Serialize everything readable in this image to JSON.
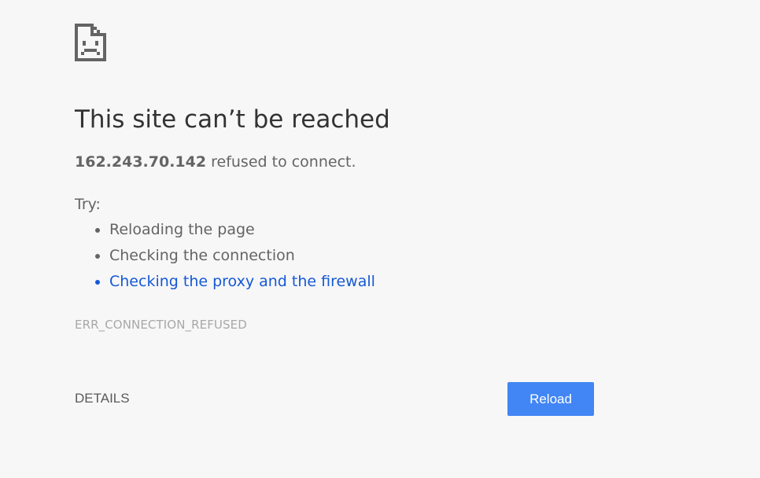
{
  "page": {
    "icon": "sad-page-icon",
    "title": "This site can’t be reached",
    "summary": {
      "host": "162.243.70.142",
      "message": " refused to connect."
    },
    "try_label": "Try:",
    "suggestions": [
      "Reloading the page",
      "Checking the connection",
      "Checking the proxy and the firewall"
    ],
    "error_code": "ERR_CONNECTION_REFUSED"
  },
  "buttons": {
    "details_label": "DETAILS",
    "reload_label": "Reload"
  },
  "colors": {
    "background": "#f7f7f7",
    "title": "#333333",
    "text": "#646464",
    "link": "#1558d6",
    "error_code": "#a8a8a8",
    "reload_button": "#4285f4"
  }
}
